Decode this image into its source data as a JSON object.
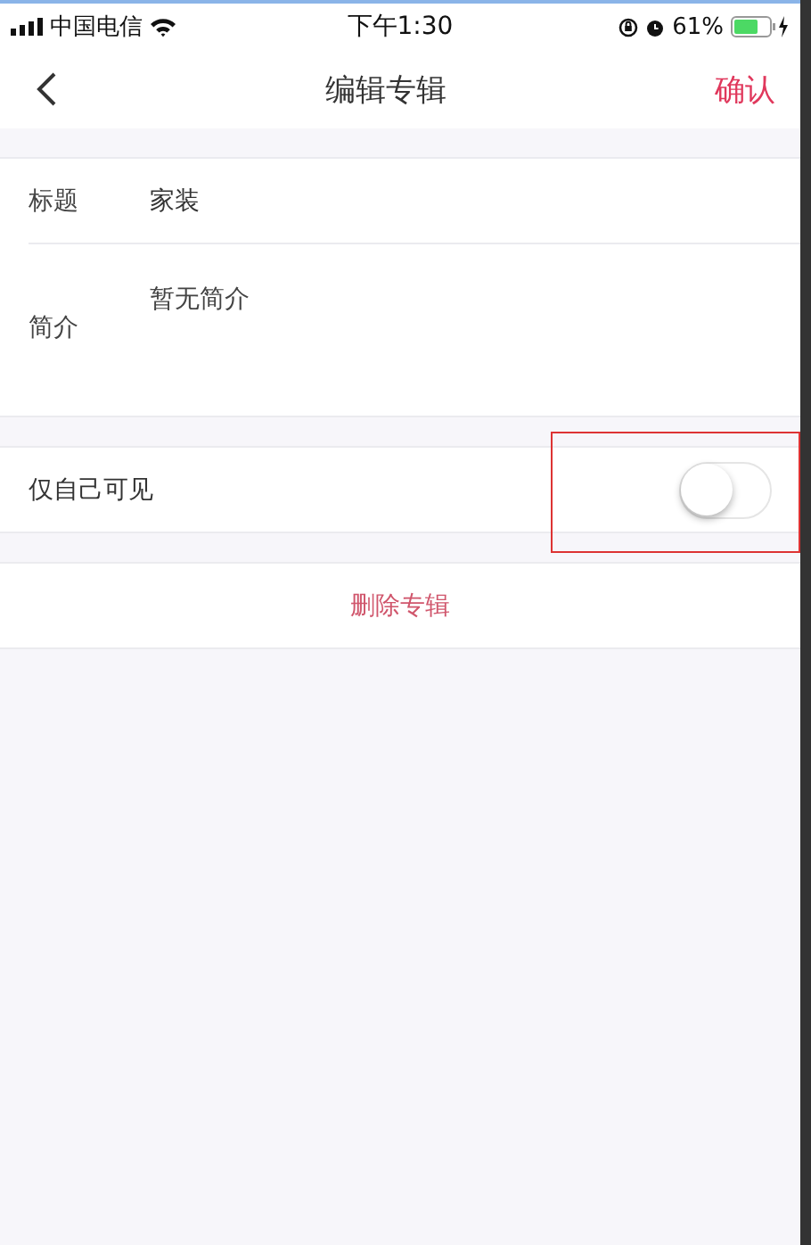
{
  "status_bar": {
    "carrier": "中国电信",
    "time": "下午1:30",
    "battery": "61%"
  },
  "nav": {
    "title": "编辑专辑",
    "confirm": "确认"
  },
  "form": [
    {
      "label": "标题",
      "value": "家装"
    },
    {
      "label": "简介",
      "placeholder": "暂无简介"
    }
  ],
  "private_toggle": {
    "label": "仅自己可见",
    "on": false,
    "highlighted": true
  },
  "delete_button": "删除专辑"
}
